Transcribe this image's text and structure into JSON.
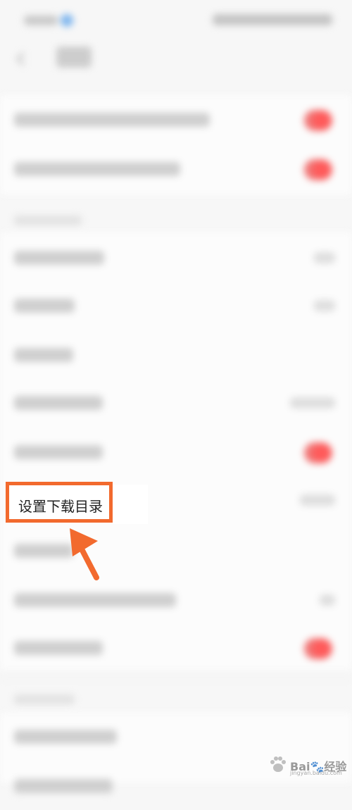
{
  "callout": {
    "label": "设置下载目录"
  },
  "watermark": {
    "text": "Bai🐾经验",
    "sub": "jingyan.baidu.com"
  },
  "colors": {
    "accent": "#f26a2e",
    "toggle_on": "#ff5a5a"
  },
  "icons": {
    "back": "back-arrow-icon",
    "pointer": "arrow-pointer-icon",
    "watermark": "baidu-paw-icon"
  }
}
